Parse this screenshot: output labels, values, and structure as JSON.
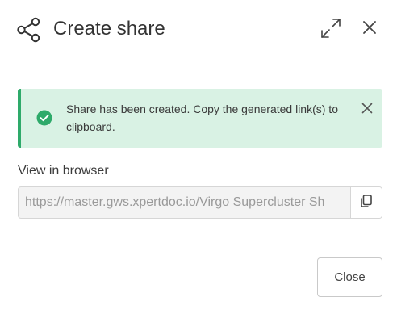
{
  "dialog": {
    "title": "Create share",
    "title_icon": "share-icon",
    "expand_icon": "expand-icon",
    "close_icon": "close-icon"
  },
  "alert": {
    "icon": "check-circle-icon",
    "message": "Share has been created. Copy the generated link(s) to clipboard.",
    "close_icon": "close-icon",
    "color": "#2eaa6a",
    "background": "#d9f2e4"
  },
  "field": {
    "label": "View in browser",
    "value": "https://master.gws.xpertdoc.io/Virgo Supercluster Sh",
    "copy_icon": "copy-icon"
  },
  "footer": {
    "close_label": "Close"
  }
}
